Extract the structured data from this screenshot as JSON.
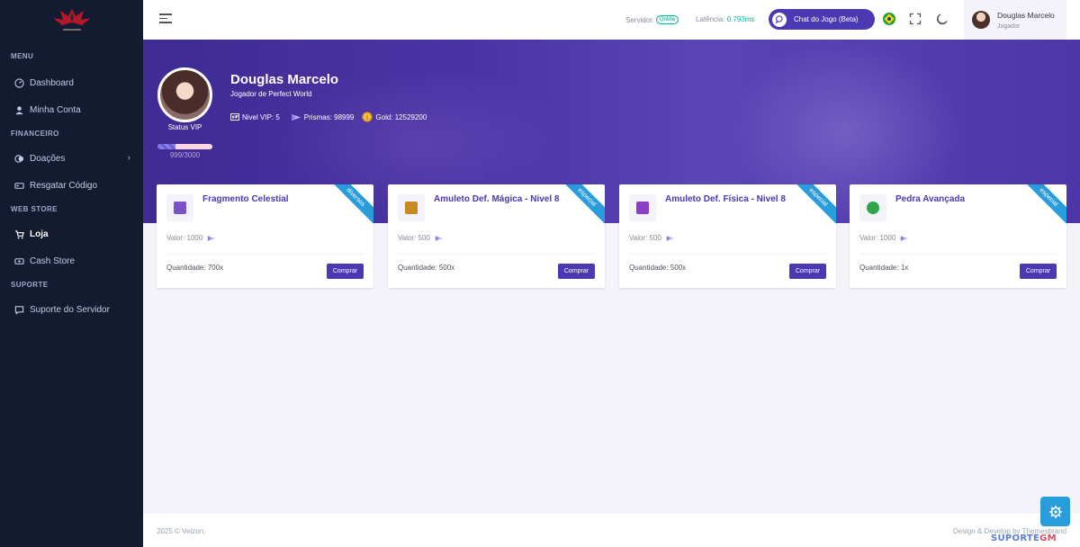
{
  "sidebar": {
    "sections": {
      "menu": "MENU",
      "financeiro": "FINANCEIRO",
      "webstore": "WEB STORE",
      "suporte": "SUPORTE"
    },
    "items": {
      "dashboard": "Dashboard",
      "minha_conta": "Minha Conta",
      "doacoes": "Doações",
      "resgatar": "Resgatar Código",
      "loja": "Loja",
      "cash_store": "Cash Store",
      "suporte_servidor": "Suporte do Servidor"
    }
  },
  "header": {
    "server_label": "Servidor:",
    "server_status": "Online",
    "latency_label": "Latência:",
    "latency_value": "0.793ms",
    "chat_button": "Chat do Jogo (Beta)",
    "user_name": "Douglas Marcelo",
    "user_role": "Jogador"
  },
  "profile": {
    "name": "Douglas Marcelo",
    "subtitle": "Jogador de Perfect World",
    "status_label": "Status VIP",
    "vip_progress_text": "999/3000",
    "vip_progress": 0.333,
    "vip_level": "Nivel VIP: 5",
    "prismas": "Prismas: 98999",
    "gold": "Gold: 12529200"
  },
  "store": {
    "buy_label": "Comprar",
    "items": [
      {
        "name": "Fragmento Celestial",
        "ribbon": "diversos",
        "valor": "Valor: 1000",
        "quantidade": "Quantidade: 700x",
        "color": "#7a52c7"
      },
      {
        "name": "Amuleto Def. Mágica - Nivel 8",
        "ribbon": "especial",
        "valor": "Valor: 500",
        "quantidade": "Quantidade: 500x",
        "color": "#c8891f"
      },
      {
        "name": "Amuleto Def. Física - Nivel 8",
        "ribbon": "especial",
        "valor": "Valor: 500",
        "quantidade": "Quantidade: 500x",
        "color": "#8a3fc4"
      },
      {
        "name": "Pedra Avançada",
        "ribbon": "especial",
        "valor": "Valor: 1000",
        "quantidade": "Quantidade: 1x",
        "color": "#2fa64a"
      }
    ]
  },
  "footer": {
    "copyright": "2025 © Velzon.",
    "credit": "Design & Develop by Themesbrand"
  },
  "watermark": {
    "part1": "SUPORTE",
    "part2": "GM"
  },
  "colors": {
    "primary": "#4b38b3",
    "sidebar": "#141a2f",
    "ribbon": "#299cdb",
    "success": "#0ab39c"
  }
}
